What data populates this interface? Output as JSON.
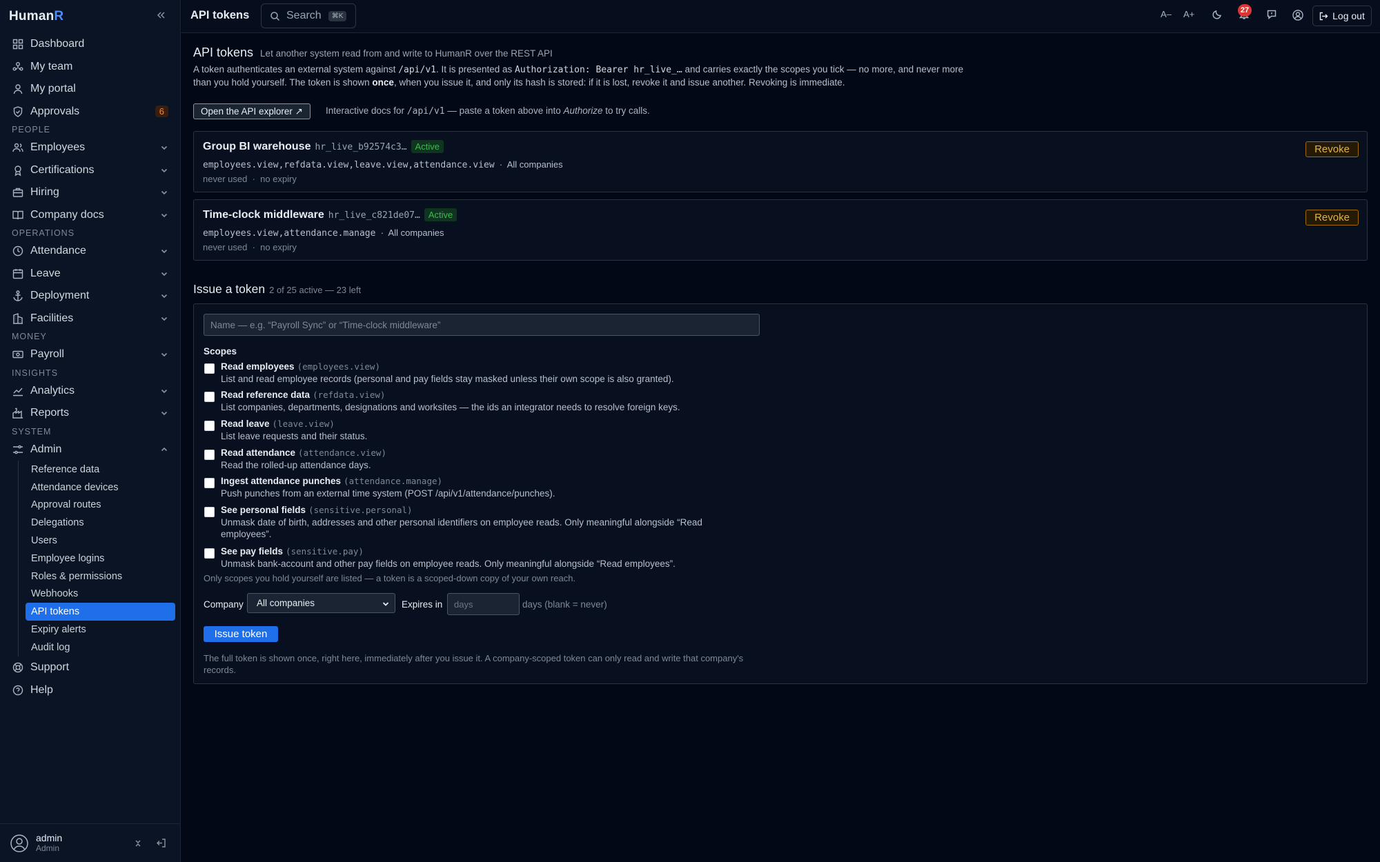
{
  "app": {
    "name_a": "Human",
    "name_b": "R"
  },
  "sidebar": {
    "top": [
      {
        "label": "Dashboard",
        "icon": "grid-icon"
      },
      {
        "label": "My team",
        "icon": "team-icon"
      },
      {
        "label": "My portal",
        "icon": "person-icon"
      },
      {
        "label": "Approvals",
        "icon": "shield-check-icon",
        "badge": "6"
      }
    ],
    "sections": {
      "people": "PEOPLE",
      "operations": "OPERATIONS",
      "money": "MONEY",
      "insights": "INSIGHTS",
      "system": "SYSTEM"
    },
    "people": [
      "Employees",
      "Certifications",
      "Hiring",
      "Company docs"
    ],
    "operations": [
      "Attendance",
      "Leave",
      "Deployment",
      "Facilities"
    ],
    "money": [
      "Payroll"
    ],
    "insights": [
      "Analytics",
      "Reports"
    ],
    "admin": "Admin",
    "admin_items": [
      "Reference data",
      "Attendance devices",
      "Approval routes",
      "Delegations",
      "Users",
      "Employee logins",
      "Roles & permissions",
      "Webhooks",
      "API tokens",
      "Expiry alerts",
      "Audit log"
    ],
    "bottom": [
      "Support",
      "Help"
    ],
    "user": {
      "name": "admin",
      "role": "Admin"
    }
  },
  "topbar": {
    "title": "API tokens",
    "search_label": "Search",
    "search_kbd": "⌘K",
    "font_dec": "A–",
    "font_inc": "A+",
    "notif_count": "27",
    "logout": "Log out"
  },
  "page": {
    "heading": "API tokens",
    "heading_sub": "Let another system read from and write to HumanR over the REST API",
    "intro": {
      "t1": "A token authenticates an external system against ",
      "c1": "/api/v1",
      "t2": ". It is presented as ",
      "c2": "Authorization: Bearer hr_live_…",
      "t3": " and carries exactly the scopes you tick — no more, and never more than you hold yourself. The token is shown ",
      "b1": "once",
      "t4": ", when you issue it, and only its hash is stored: if it is lost, revoke it and issue another. Revoking is immediate."
    },
    "explorer_btn": "Open the API explorer ↗",
    "explorer_note": {
      "t1": "Interactive docs for ",
      "c1": "/api/v1",
      "t2": " — paste a token above into ",
      "i1": "Authorize",
      "t3": " to try calls."
    }
  },
  "tokens": [
    {
      "name": "Group BI warehouse",
      "prefix": "hr_live_b92574c3…",
      "status": "Active",
      "scopes": "employees.view,refdata.view,leave.view,attendance.view",
      "sep": "·",
      "company": "All companies",
      "used": "never used",
      "expiry": "no expiry",
      "revoke": "Revoke"
    },
    {
      "name": "Time-clock middleware",
      "prefix": "hr_live_c821de07…",
      "status": "Active",
      "scopes": "employees.view,attendance.manage",
      "sep": "·",
      "company": "All companies",
      "used": "never used",
      "expiry": "no expiry",
      "revoke": "Revoke"
    }
  ],
  "issue": {
    "heading": "Issue a token",
    "count": "2 of 25 active — 23 left",
    "name_placeholder": "Name — e.g. “Payroll Sync” or “Time-clock middleware”",
    "scopes_heading": "Scopes",
    "scopes": [
      {
        "label": "Read employees",
        "code": "(employees.view)",
        "desc": "List and read employee records (personal and pay fields stay masked unless their own scope is also granted)."
      },
      {
        "label": "Read reference data",
        "code": "(refdata.view)",
        "desc": "List companies, departments, designations and worksites — the ids an integrator needs to resolve foreign keys."
      },
      {
        "label": "Read leave",
        "code": "(leave.view)",
        "desc": "List leave requests and their status."
      },
      {
        "label": "Read attendance",
        "code": "(attendance.view)",
        "desc": "Read the rolled-up attendance days."
      },
      {
        "label": "Ingest attendance punches",
        "code": "(attendance.manage)",
        "desc": "Push punches from an external time system (POST /api/v1/attendance/punches)."
      },
      {
        "label": "See personal fields",
        "code": "(sensitive.personal)",
        "desc": "Unmask date of birth, addresses and other personal identifiers on employee reads. Only meaningful alongside “Read employees”."
      },
      {
        "label": "See pay fields",
        "code": "(sensitive.pay)",
        "desc": "Unmask bank-account and other pay fields on employee reads. Only meaningful alongside “Read employees”."
      }
    ],
    "scopes_note": "Only scopes you hold yourself are listed — a token is a scoped-down copy of your own reach.",
    "company_label": "Company",
    "company_value": "All companies",
    "expires_label": "Expires in",
    "expires_placeholder": "days",
    "expires_note": "days (blank = never)",
    "issue_btn": "Issue token",
    "footer": "The full token is shown once, right here, immediately after you issue it. A company-scoped token can only read and write that company's records."
  },
  "colors": {
    "accent": "#1f6feb",
    "active_green": "#3fb950",
    "revoke_amber": "#e3b341",
    "badge_orange": "#f0883e",
    "notif_red": "#da3633"
  }
}
